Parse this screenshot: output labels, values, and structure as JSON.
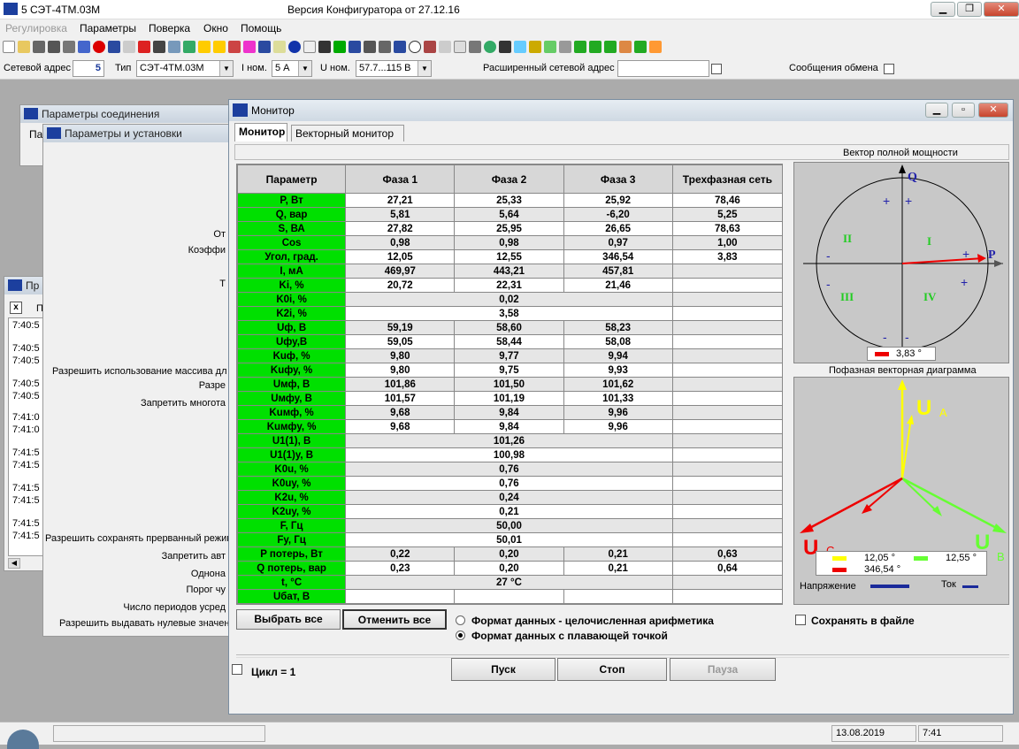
{
  "app": {
    "title": "5  СЭТ-4ТМ.03М",
    "version": "Версия Конфигуратора  от 27.12.16"
  },
  "menu": {
    "items": [
      "Регулировка",
      "Параметры",
      "Поверка",
      "Окно",
      "Помощь"
    ]
  },
  "addressbar": {
    "net_addr_label": "Сетевой адрес",
    "net_addr_value": "5",
    "type_label": "Тип",
    "type_value": "СЭТ-4ТМ.03М",
    "inom_label": "I ном.",
    "inom_value": "5 А",
    "unom_label": "U ном.",
    "unom_value": "57.7...115 В",
    "ext_addr_label": "Расширенный сетевой адрес",
    "exchange_label": "Сообщения обмена"
  },
  "bg_windows": {
    "connection_title": "Параметры соединения",
    "settings_title": "Параметры и установки",
    "pr_title": "Пр",
    "log_times": [
      "7:40:5",
      "7:40:5",
      "7:40:5",
      "7:40:5",
      "7:40:5",
      "7:41:0",
      "7:41:0",
      "7:41:5",
      "7:41:5",
      "7:41:5",
      "7:41:5",
      "7:41:5",
      "7:41:5"
    ],
    "settings_lines": [
      "От",
      "Коэффи",
      "Т",
      "Разрешить использование массива дл",
      "Разре",
      "Запретить многота",
      "Разрешить сохранять прерванный режим",
      "Запретить авт",
      "Однона",
      "Порог чу",
      "Число периодов усред",
      "Разрешить выдавать нулевые значен"
    ]
  },
  "monitor": {
    "title": "Монитор",
    "tabs": [
      "Монитор",
      "Векторный монитор"
    ],
    "columns": [
      "Параметр",
      "Фаза 1",
      "Фаза 2",
      "Фаза 3",
      "Трехфазная сеть"
    ],
    "rows": [
      {
        "p": "P, Вт",
        "f1": "27,21",
        "f2": "25,33",
        "f3": "25,92",
        "t": "78,46"
      },
      {
        "p": "Q, вар",
        "f1": "5,81",
        "f2": "5,64",
        "f3": "-6,20",
        "t": "5,25"
      },
      {
        "p": "S, ВА",
        "f1": "27,82",
        "f2": "25,95",
        "f3": "26,65",
        "t": "78,63"
      },
      {
        "p": "Cos",
        "f1": "0,98",
        "f2": "0,98",
        "f3": "0,97",
        "t": "1,00"
      },
      {
        "p": "Угол, град.",
        "f1": "12,05",
        "f2": "12,55",
        "f3": "346,54",
        "t": "3,83"
      },
      {
        "p": "I, мА",
        "f1": "469,97",
        "f2": "443,21",
        "f3": "457,81",
        "t": ""
      },
      {
        "p": "Ki, %",
        "f1": "20,72",
        "f2": "22,31",
        "f3": "21,46",
        "t": ""
      },
      {
        "p": "K0i, %",
        "merged": "0,02"
      },
      {
        "p": "K2i, %",
        "merged": "3,58"
      },
      {
        "p": "Uф, В",
        "f1": "59,19",
        "f2": "58,60",
        "f3": "58,23",
        "t": ""
      },
      {
        "p": "Uфу,В",
        "f1": "59,05",
        "f2": "58,44",
        "f3": "58,08",
        "t": ""
      },
      {
        "p": "Kuф, %",
        "f1": "9,80",
        "f2": "9,77",
        "f3": "9,94",
        "t": ""
      },
      {
        "p": "Kuфу, %",
        "f1": "9,80",
        "f2": "9,75",
        "f3": "9,93",
        "t": ""
      },
      {
        "p": "Uмф, В",
        "f1": "101,86",
        "f2": "101,50",
        "f3": "101,62",
        "t": ""
      },
      {
        "p": "Uмфу, В",
        "f1": "101,57",
        "f2": "101,19",
        "f3": "101,33",
        "t": ""
      },
      {
        "p": "Kuмф, %",
        "f1": "9,68",
        "f2": "9,84",
        "f3": "9,96",
        "t": ""
      },
      {
        "p": "Kuмфу, %",
        "f1": "9,68",
        "f2": "9,84",
        "f3": "9,96",
        "t": ""
      },
      {
        "p": "U1(1), В",
        "merged": "101,26"
      },
      {
        "p": "U1(1)у, В",
        "merged": "100,98"
      },
      {
        "p": "K0u, %",
        "merged": "0,76"
      },
      {
        "p": "K0uy, %",
        "merged": "0,76"
      },
      {
        "p": "K2u, %",
        "merged": "0,24"
      },
      {
        "p": "K2uy, %",
        "merged": "0,21"
      },
      {
        "p": "F, Гц",
        "merged": "50,00"
      },
      {
        "p": "Fy, Гц",
        "merged": "50,01"
      },
      {
        "p": "P потерь, Вт",
        "f1": "0,22",
        "f2": "0,20",
        "f3": "0,21",
        "t": "0,63"
      },
      {
        "p": "Q потерь, вар",
        "f1": "0,23",
        "f2": "0,20",
        "f3": "0,21",
        "t": "0,64"
      },
      {
        "p": "t, °C",
        "merged": "27 °C"
      },
      {
        "p": "Uбат, В",
        "f1": "",
        "f2": "",
        "f3": "",
        "t": ""
      }
    ],
    "select_all": "Выбрать все",
    "cancel_all": "Отменить все",
    "format_int": "Формат данных - целочисленная арифметика",
    "format_float": "Формат данных с плавающей точкой",
    "save_file": "Сохранять в файле",
    "cycle": "Цикл = 1",
    "start": "Пуск",
    "stop": "Стоп",
    "pause": "Пауза",
    "power_vector_title": "Вектор полной мощности",
    "axis_q": "Q",
    "axis_p": "P",
    "quadrants": [
      "I",
      "II",
      "III",
      "IV"
    ],
    "power_angle": "3,83 °",
    "phase_diag_title": "Пофазная векторная диаграмма",
    "phase_label_a": "A",
    "phase_label_b": "B",
    "phase_label_c": "C",
    "angles": [
      "12,05 °",
      "12,55 °",
      "346,54 °"
    ],
    "voltage_label": "Напряжение",
    "current_label": "Ток",
    "colors": {
      "phase_a": "#ffff00",
      "phase_b": "#66ff33",
      "phase_c": "#ff0000",
      "param_bg": "#00e000"
    }
  },
  "status": {
    "date": "13.08.2019",
    "time": "7:41"
  }
}
